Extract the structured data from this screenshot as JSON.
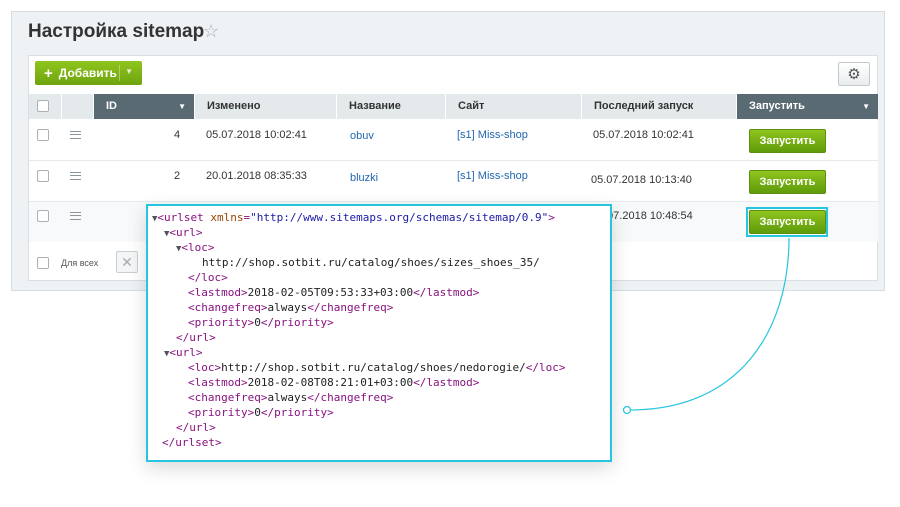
{
  "page": {
    "title": "Настройка sitemap"
  },
  "toolbar": {
    "add_label": "Добавить"
  },
  "table": {
    "headers": {
      "id": "ID",
      "changed": "Изменено",
      "name": "Название",
      "site": "Сайт",
      "last_run": "Последний запуск",
      "run": "Запустить"
    },
    "rows": [
      {
        "id": "4",
        "changed": "05.07.2018 10:02:41",
        "name": "obuv",
        "site": "[s1] Miss-shop",
        "last_run": "05.07.2018 10:02:41",
        "run_label": "Запустить"
      },
      {
        "id": "2",
        "changed": "20.01.2018 08:35:33",
        "name": "bluzki",
        "site": "[s1] Miss-shop",
        "last_run": "05.07.2018 10:13:40",
        "run_label": "Запустить"
      },
      {
        "last_run": ".07.2018 10:48:54",
        "run_label": "Запустить"
      }
    ],
    "footer": {
      "for_all": "Для всех"
    }
  },
  "xml": {
    "urlset_open_tag": "urlset",
    "urlset_attr_name": "xmlns",
    "urlset_attr_value": "\"http://www.sitemaps.org/schemas/sitemap/0.9\"",
    "url_tag": "url",
    "loc_tag": "loc",
    "lastmod_tag": "lastmod",
    "changefreq_tag": "changefreq",
    "priority_tag": "priority",
    "url1": {
      "loc": "http://shop.sotbit.ru/catalog/shoes/sizes_shoes_35/",
      "lastmod": "2018-02-05T09:53:33+03:00",
      "changefreq": "always",
      "priority": "0"
    },
    "url2": {
      "loc": "http://shop.sotbit.ru/catalog/shoes/nedorogie/",
      "lastmod": "2018-02-08T08:21:01+03:00",
      "changefreq": "always",
      "priority": "0"
    }
  },
  "colors": {
    "accent": "#27c5e0",
    "button_green": "#7ab317",
    "header_dark": "#5a6a73"
  },
  "icons": {
    "star": "star-icon",
    "gear": "gear-icon",
    "menu": "menu-icon",
    "close": "close-icon",
    "triangle": "expand-triangle-icon"
  }
}
